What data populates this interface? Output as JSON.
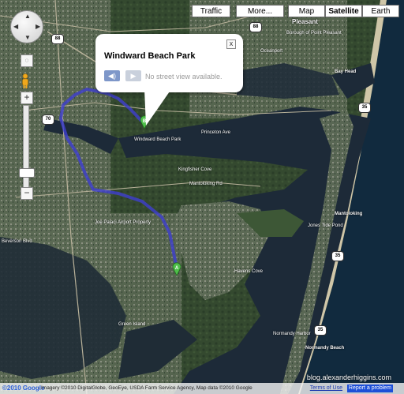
{
  "map_types": {
    "traffic": "Traffic",
    "more": "More...",
    "map": "Map",
    "satellite": "Satellite",
    "earth": "Earth",
    "active": "satellite"
  },
  "controls": {
    "zoom_in": "+",
    "zoom_out": "−",
    "close": "x"
  },
  "info_window": {
    "title": "Windward Beach Park",
    "street_view_text": "No street view available."
  },
  "markers": {
    "a": "A",
    "b": "B"
  },
  "route_color": "#3f3fd0",
  "place_labels": {
    "windward_beach_park": "Windward Beach Park",
    "kingfisher_cove": "Kingfisher Cove",
    "mantoloking_rd": "Mantoloking Rd",
    "mantoloking": "Mantoloking",
    "pleasant": "Pleasant",
    "borough_point_pleasant": "Borough of Point Pleasant",
    "oceanport": "Oceanport",
    "bay_head": "Bay Head",
    "jones_tide_pond": "Jones Tide Pond",
    "havens_cove": "Havens Cove",
    "normandy_harbor": "Normandy Harbor",
    "normandy_beach": "Normandy Beach",
    "green_island": "Green Island",
    "joe_palaci": "Joe Palaci Airport Property",
    "beverson_blvd": "Beverson Blvd",
    "princeton_ave": "Princeton Ave"
  },
  "route_shields": {
    "r88a": "88",
    "r88b": "88",
    "r70": "70",
    "r35a": "35",
    "r35b": "35",
    "r35c": "35"
  },
  "footer": {
    "copyright": "©2010 Google",
    "attribution": " - Imagery ©2010 DigitalGlobe, GeoEye, USDA Farm Service Agency, Map data ©2010 Google",
    "terms": "Terms of Use",
    "report": "Report a problem",
    "watermark": "blog.alexanderhiggins.com"
  }
}
